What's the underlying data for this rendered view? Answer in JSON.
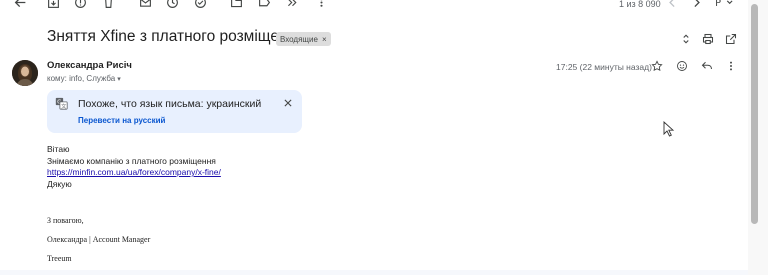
{
  "toolbar": {
    "icons": [
      "back-arrow-icon",
      "archive-icon",
      "report-spam-icon",
      "delete-icon",
      "mark-unread-icon",
      "snooze-icon",
      "add-task-icon",
      "move-to-icon",
      "label-icon",
      "more-icon"
    ],
    "pager": "1 из 8 090"
  },
  "email": {
    "subject": "Зняття Xfine з платного розміщення",
    "label_chip": "Входящие",
    "label_chip_remove": "×",
    "sender_name": "Олександра Рисіч",
    "recipients": "кому: info, Служба",
    "timestamp": "17:25 (22 минуты назад)"
  },
  "translate": {
    "title": "Похоже, что язык письма: украинский",
    "action": "Перевести на русский"
  },
  "body": {
    "greeting": "Вітаю",
    "line1": "Знімаємо компанію з платного розміщення",
    "link": "https://minfin.com.ua/ua/forex/company/x-fine/",
    "thanks": "Дякую",
    "sig1": "З повагою,",
    "sig2": "Олександра | Account Manager",
    "sig3": "Treeum"
  },
  "colors": {
    "accent_link": "#0b57d0",
    "translate_bg": "#e8f0fe",
    "body_link": "#1a0dab"
  }
}
